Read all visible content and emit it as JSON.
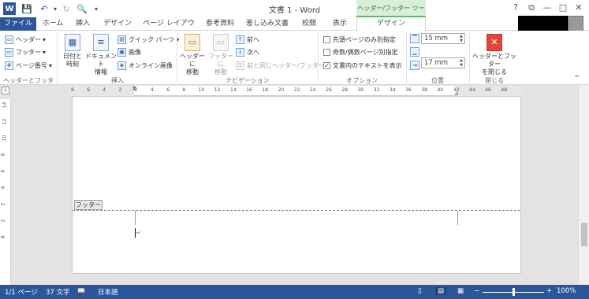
{
  "window": {
    "title": "文書 1 - Word",
    "context_tab_header": "ヘッダー/フッター ツール"
  },
  "qat": {
    "word_icon": "W",
    "save_icon": "save-icon",
    "undo_icon": "undo-icon",
    "redo_icon": "redo-icon",
    "preview_icon": "print-preview-icon",
    "customize_icon": "customize-icon"
  },
  "window_controls": {
    "help": "?",
    "restore_ribbon": "⧉",
    "minimize": "—",
    "maximize": "□",
    "close": "✕"
  },
  "tabs": [
    "ファイル",
    "ホーム",
    "挿入",
    "デザイン",
    "ページ レイアウト",
    "参考資料",
    "差し込み文書",
    "校閲",
    "表示",
    "デザイン"
  ],
  "ribbon": {
    "hf_group": {
      "header": "ヘッダー",
      "footer": "フッター",
      "page_number": "ページ番号",
      "label": "ヘッダーとフッター"
    },
    "insert_group": {
      "date_time": [
        "日付と",
        "時刻"
      ],
      "doc_info": [
        "ドキュメント",
        "情報"
      ],
      "quick_parts": "クイック パーツ",
      "picture": "画像",
      "online_picture": "オンライン画像",
      "label": "挿入"
    },
    "nav_group": {
      "goto_header": [
        "ヘッダーに",
        "移動"
      ],
      "goto_footer": [
        "フッターに",
        "移動"
      ],
      "prev": "前へ",
      "next": "次へ",
      "link_prev": "前と同じヘッダー/フッター",
      "label": "ナビゲーション"
    },
    "options_group": {
      "first_page": "先頭ページのみ別指定",
      "odd_even": "奇数/偶数ページ別指定",
      "show_text": "文書内のテキストを表示",
      "label": "オプション"
    },
    "position_group": {
      "header_pos": "15 mm",
      "footer_pos": "17 mm",
      "label": "位置"
    },
    "close_group": {
      "close_btn": [
        "ヘッダーとフッター",
        "を閉じる"
      ],
      "label": "閉じる"
    }
  },
  "rulers": {
    "horizontal_ticks": [
      "8",
      "6",
      "4",
      "2",
      "2",
      "4",
      "6",
      "8",
      "10",
      "12",
      "14",
      "16",
      "18",
      "20",
      "22",
      "24",
      "26",
      "28",
      "30",
      "32",
      "34",
      "36",
      "38",
      "40",
      "42",
      "44",
      "46",
      "48"
    ],
    "vertical_ticks": [
      "14",
      "12",
      "10",
      "8",
      "6",
      "4",
      "2",
      "2",
      "4"
    ]
  },
  "document": {
    "footer_tag": "フッター"
  },
  "status": {
    "page": "1/1 ページ",
    "words": "37 文字",
    "language": "日本語",
    "zoom": "100%",
    "zoom_minus": "−",
    "zoom_plus": "+"
  },
  "colors": {
    "accent": "#2b579a",
    "context": "#217346",
    "close_red": "#e1463a"
  }
}
